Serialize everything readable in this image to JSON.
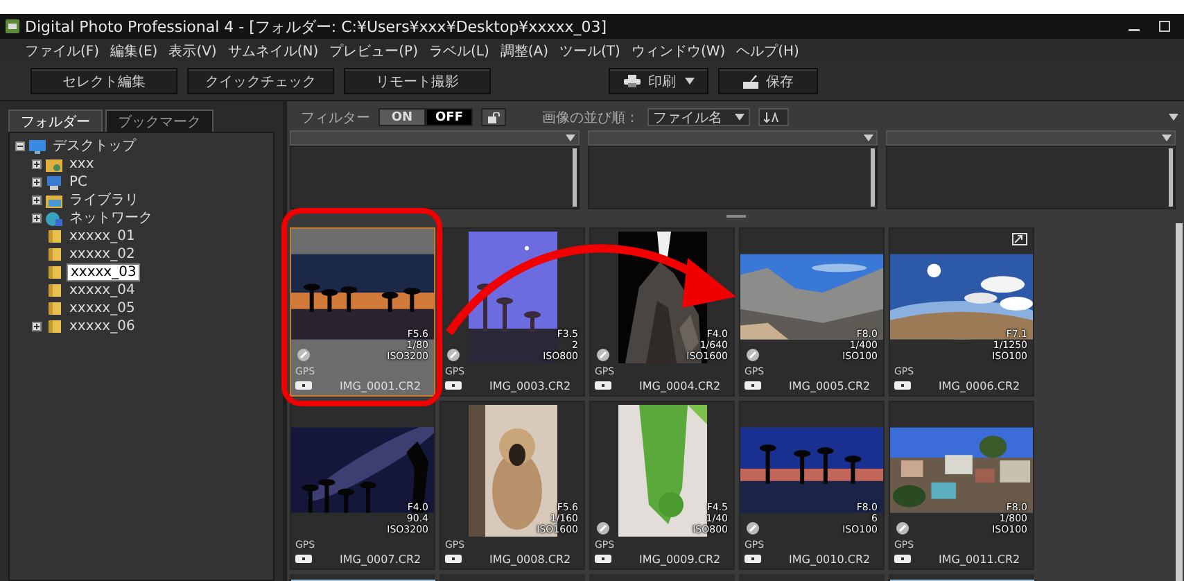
{
  "window": {
    "title": "Digital Photo Professional 4 - [フォルダー: C:¥Users¥xxx¥Desktop¥xxxxx_03]"
  },
  "menu": [
    "ファイル(F)",
    "編集(E)",
    "表示(V)",
    "サムネイル(N)",
    "プレビュー(P)",
    "ラベル(L)",
    "調整(A)",
    "ツール(T)",
    "ウィンドウ(W)",
    "ヘルプ(H)"
  ],
  "toolbar": {
    "left": [
      {
        "label": "セレクト編集"
      },
      {
        "label": "クイックチェック"
      },
      {
        "label": "リモート撮影"
      }
    ],
    "right": [
      {
        "label": "印刷",
        "kind": "print"
      },
      {
        "label": "保存",
        "kind": "save"
      }
    ]
  },
  "panel_tabs": [
    {
      "label": "フォルダー",
      "selected": true
    },
    {
      "label": "ブックマーク",
      "selected": false
    }
  ],
  "tree": [
    {
      "label": "デスクトップ",
      "kind": "desktop",
      "expanded": true,
      "selected": false,
      "children": [
        {
          "label": "xxx",
          "kind": "user",
          "expanded": false,
          "selected": false
        },
        {
          "label": "PC",
          "kind": "pc",
          "expanded": false,
          "selected": false
        },
        {
          "label": "ライブラリ",
          "kind": "library",
          "expanded": false,
          "selected": false
        },
        {
          "label": "ネットワーク",
          "kind": "network",
          "expanded": false,
          "selected": false
        },
        {
          "label": "xxxxx_01",
          "kind": "folder",
          "selected": false
        },
        {
          "label": "xxxxx_02",
          "kind": "folder",
          "selected": false
        },
        {
          "label": "xxxxx_03",
          "kind": "folder",
          "selected": true
        },
        {
          "label": "xxxxx_04",
          "kind": "folder",
          "selected": false
        },
        {
          "label": "xxxxx_05",
          "kind": "folder",
          "selected": false
        },
        {
          "label": "xxxxx_06",
          "kind": "folder",
          "expanded": false,
          "selected": false
        }
      ]
    }
  ],
  "filter": {
    "label": "フィルター",
    "options": [
      {
        "label": "ON",
        "selected": false
      },
      {
        "label": "OFF",
        "selected": true
      }
    ],
    "sort_label": "画像の並び順：",
    "sort_value": "ファイル名"
  },
  "thumbnails": [
    {
      "file": "IMG_0001.CR2",
      "exposure": [
        "F5.6",
        "1/80",
        "ISO3200"
      ],
      "gps": "GPS",
      "marked": true,
      "enlarge": false,
      "selected": true
    },
    {
      "file": "IMG_0003.CR2",
      "exposure": [
        "F3.5",
        "2",
        "ISO800"
      ],
      "gps": "GPS",
      "marked": true,
      "enlarge": false,
      "selected": false
    },
    {
      "file": "IMG_0004.CR2",
      "exposure": [
        "F4.0",
        "1/640",
        "ISO1600"
      ],
      "gps": "GPS",
      "marked": true,
      "enlarge": false,
      "selected": false
    },
    {
      "file": "IMG_0005.CR2",
      "exposure": [
        "F8.0",
        "1/400",
        "ISO100"
      ],
      "gps": "GPS",
      "marked": true,
      "enlarge": false,
      "selected": false
    },
    {
      "file": "IMG_0006.CR2",
      "exposure": [
        "F7.1",
        "1/1250",
        "ISO100"
      ],
      "gps": "GPS",
      "marked": false,
      "enlarge": true,
      "selected": false
    },
    {
      "file": "IMG_0007.CR2",
      "exposure": [
        "F4.0",
        "90.4",
        "ISO3200"
      ],
      "gps": "GPS",
      "marked": false,
      "enlarge": false,
      "selected": false
    },
    {
      "file": "IMG_0008.CR2",
      "exposure": [
        "F5.6",
        "1/160",
        "ISO1600"
      ],
      "gps": "GPS",
      "marked": false,
      "enlarge": false,
      "selected": false
    },
    {
      "file": "IMG_0009.CR2",
      "exposure": [
        "F4.5",
        "1/40",
        "ISO800"
      ],
      "gps": "GPS",
      "marked": true,
      "enlarge": false,
      "selected": false
    },
    {
      "file": "IMG_0010.CR2",
      "exposure": [
        "F8.0",
        "6",
        "ISO100"
      ],
      "gps": "GPS",
      "marked": true,
      "enlarge": false,
      "selected": false
    },
    {
      "file": "IMG_0011.CR2",
      "exposure": [
        "F8.0",
        "1/800",
        "ISO100"
      ],
      "gps": "GPS",
      "marked": true,
      "enlarge": false,
      "selected": false
    }
  ],
  "partial_thumbnails": [
    {
      "kind": "picture"
    },
    {
      "kind": "empty"
    },
    {
      "kind": "empty"
    },
    {
      "kind": "empty"
    },
    {
      "kind": "picture"
    }
  ],
  "annotations": {
    "frame": true,
    "arrow": true
  }
}
